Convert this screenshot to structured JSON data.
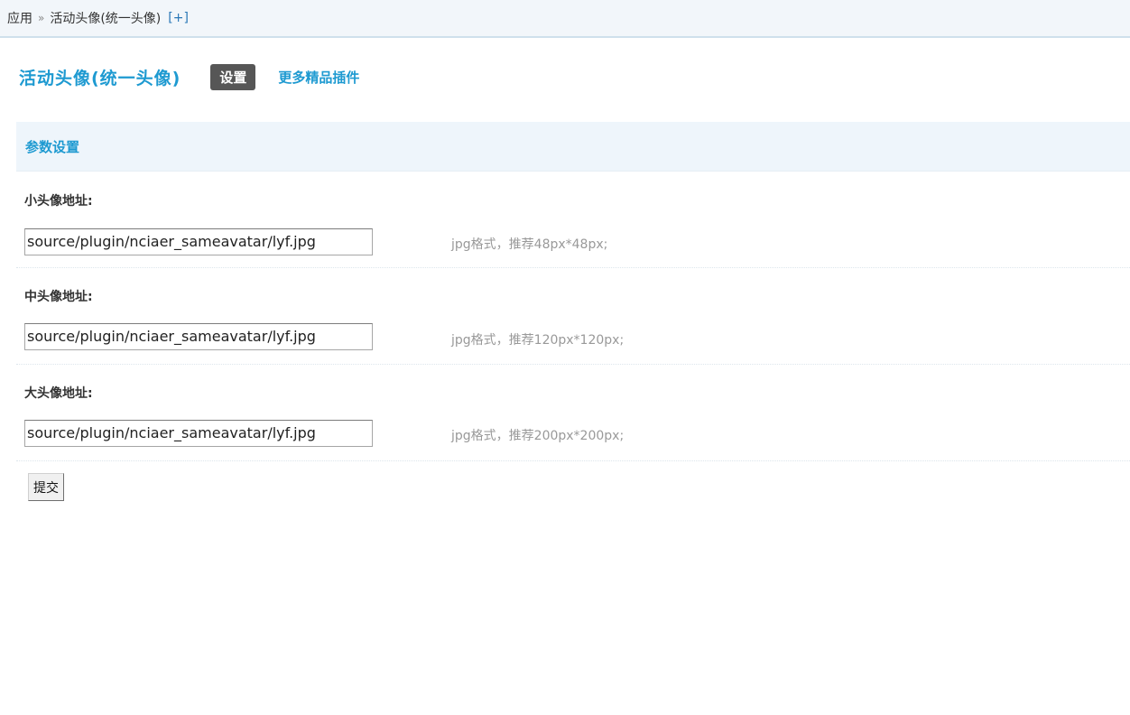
{
  "breadcrumb": {
    "root": "应用",
    "separator": "»",
    "current": "活动头像(统一头像)",
    "add_link": "[+]"
  },
  "header": {
    "plugin_title": "活动头像(统一头像)",
    "tab_settings": "设置",
    "more_plugins": "更多精品插件"
  },
  "section": {
    "title": "参数设置"
  },
  "fields": [
    {
      "label": "小头像地址:",
      "value": "source/plugin/nciaer_sameavatar/lyf.jpg",
      "hint": "jpg格式，推荐48px*48px;"
    },
    {
      "label": "中头像地址:",
      "value": "source/plugin/nciaer_sameavatar/lyf.jpg",
      "hint": "jpg格式，推荐120px*120px;"
    },
    {
      "label": "大头像地址:",
      "value": "source/plugin/nciaer_sameavatar/lyf.jpg",
      "hint": "jpg格式，推荐200px*200px;"
    }
  ],
  "submit_label": "提交",
  "colors": {
    "accent": "#1e9ad1",
    "tab_bg": "#565656",
    "header_bg": "#eef5fb",
    "hint": "#999999"
  }
}
